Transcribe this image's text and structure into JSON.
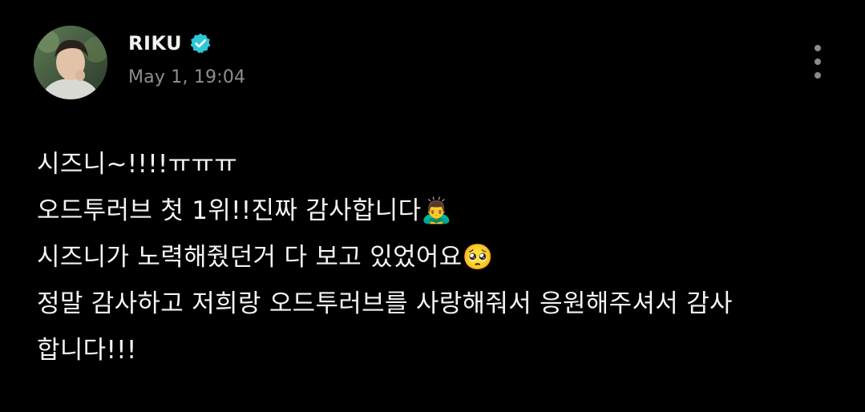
{
  "post": {
    "author": {
      "name": "RIKU",
      "avatar_icon": "profile-photo",
      "verified_icon": "verified-badge-icon",
      "verified_color": "#2fc6d8"
    },
    "timestamp": "May 1, 19:04",
    "more_icon": "more-vertical-icon",
    "lines": [
      "시즈니~!!!!ㅠㅠㅠ",
      "오드투러브 첫 1위!!진짜 감사합니다🙇‍♂️",
      "시즈니가 노력해줬던거 다 보고 있었어요🥺",
      "정말 감사하고 저희랑 오드투러브를 사랑해줘서 응원해주셔서 감사",
      "합니다!!!"
    ]
  },
  "colors": {
    "background": "#000000",
    "text": "#f4f4f4",
    "muted": "#8e8e8e"
  }
}
